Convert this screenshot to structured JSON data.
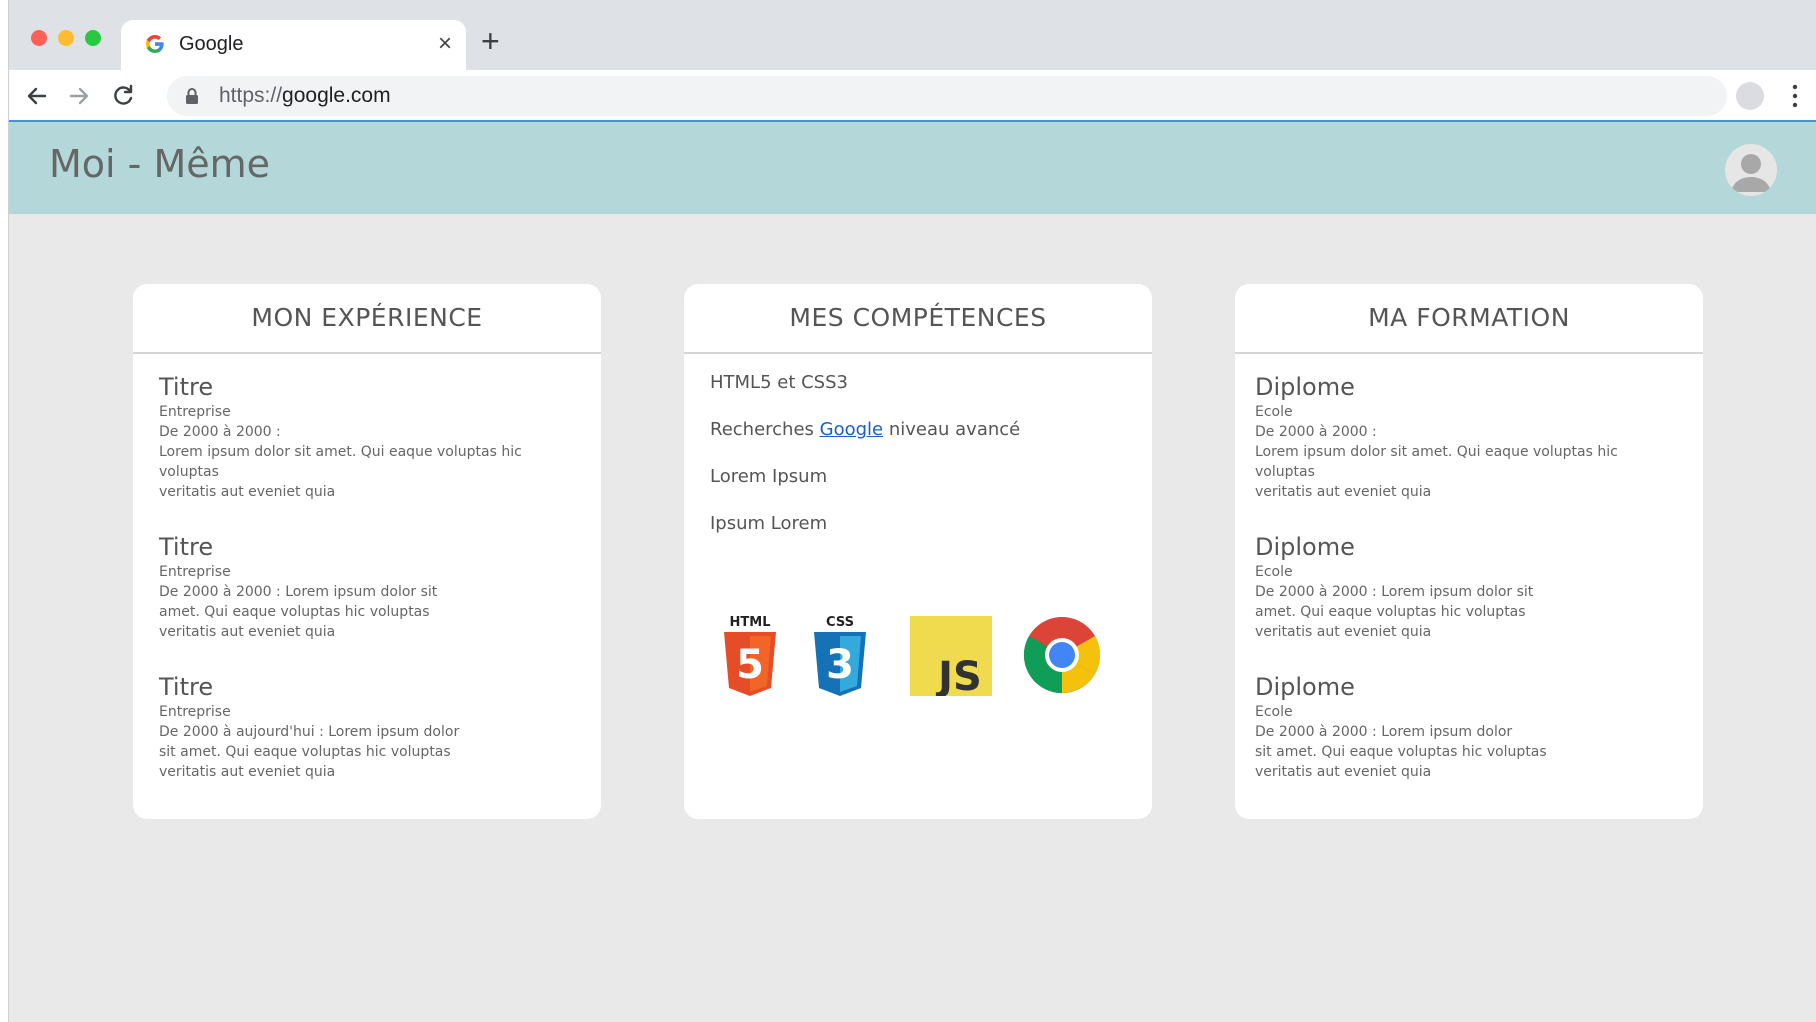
{
  "browser": {
    "tab_title": "Google",
    "tab_close": "×",
    "new_tab": "+",
    "url_scheme": "https://",
    "url_host": "google.com"
  },
  "header": {
    "title": "Moi - Même"
  },
  "experience": {
    "title": "MON EXPÉRIENCE",
    "entries": [
      {
        "title": "Titre",
        "subtitle": "Entreprise",
        "description": "De 2000 à 2000 :\nLorem ipsum dolor sit amet. Qui eaque voluptas hic voluptas\nveritatis aut eveniet quia"
      },
      {
        "title": "Titre",
        "subtitle": "Entreprise",
        "description": "De 2000 à 2000 : Lorem ipsum dolor sit\namet. Qui eaque voluptas hic voluptas\nveritatis aut eveniet quia"
      },
      {
        "title": "Titre",
        "subtitle": "Entreprise",
        "description": "De 2000 à aujourd'hui : Lorem ipsum dolor\nsit amet. Qui eaque voluptas hic voluptas\nveritatis aut eveniet quia"
      }
    ]
  },
  "skills": {
    "title": "MES COMPÉTENCES",
    "items": [
      {
        "text": "HTML5 et CSS3"
      },
      {
        "prefix": "Recherches ",
        "link": "Google",
        "suffix": " niveau avancé"
      },
      {
        "text": "Lorem Ipsum"
      },
      {
        "text": "Ipsum Lorem"
      }
    ],
    "logos": {
      "html_label": "HTML",
      "html_number": "5",
      "css_label": "CSS",
      "css_number": "3",
      "js_label": "JS"
    }
  },
  "formation": {
    "title": "MA FORMATION",
    "entries": [
      {
        "title": "Diplome",
        "subtitle": "Ecole",
        "description": "De 2000 à 2000 :\nLorem ipsum dolor sit amet. Qui eaque voluptas hic voluptas\nveritatis aut eveniet quia"
      },
      {
        "title": "Diplome",
        "subtitle": "Ecole",
        "description": "De 2000 à 2000 : Lorem ipsum dolor sit\namet. Qui eaque voluptas hic voluptas\nveritatis aut eveniet quia"
      },
      {
        "title": "Diplome",
        "subtitle": "Ecole",
        "description": "De 2000 à 2000 : Lorem ipsum dolor\nsit amet. Qui eaque voluptas hic voluptas\nveritatis aut eveniet quia"
      }
    ]
  },
  "colors": {
    "header_bg": "#b4d8d9",
    "page_bg": "#e9e9e9",
    "link": "#1a5fc8",
    "html5_orange": "#e44d26",
    "css3_blue": "#1572b6",
    "js_yellow": "#f0db4f"
  },
  "icons": {
    "back": "back-arrow-icon",
    "forward": "forward-arrow-icon",
    "reload": "reload-icon",
    "lock": "lock-icon",
    "bookmark": "star-icon",
    "menu": "kebab-menu-icon",
    "avatar": "user-avatar-icon",
    "browser_logo": "chrome-logo-icon"
  }
}
